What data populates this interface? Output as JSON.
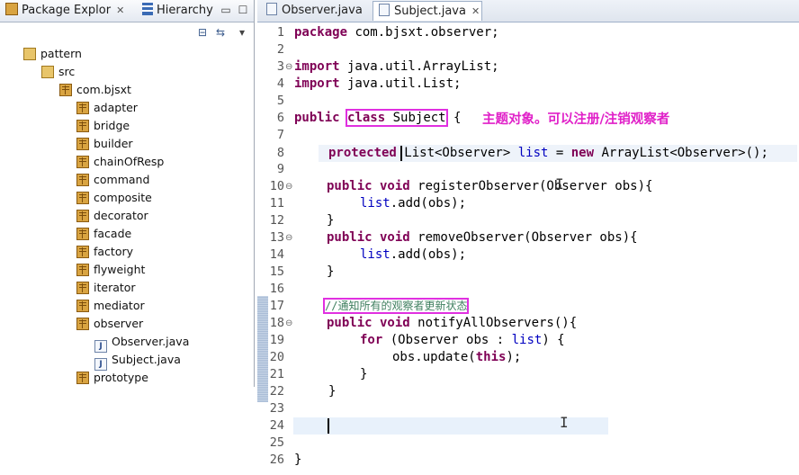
{
  "explorer": {
    "tabs": [
      {
        "label": "Package Explor",
        "close": "✕"
      },
      {
        "label": "Hierarchy",
        "close": ""
      }
    ],
    "tree": {
      "project": "pattern",
      "src": "src",
      "root_package": "com.bjsxt",
      "packages": [
        "adapter",
        "bridge",
        "builder",
        "chainOfResp",
        "command",
        "composite",
        "decorator",
        "facade",
        "factory",
        "flyweight",
        "iterator",
        "mediator",
        "observer"
      ],
      "observer_files": [
        "Observer.java",
        "Subject.java"
      ],
      "after": "prototype"
    }
  },
  "editor": {
    "tabs": [
      {
        "label": "Observer.java",
        "active": false,
        "close": ""
      },
      {
        "label": "Subject.java",
        "active": true,
        "close": "✕"
      }
    ],
    "annotation": "主题对象。可以注册/注销观察者",
    "lines": {
      "l1": {
        "kw": "package",
        "rest": " com.bjsxt.observer;"
      },
      "l3": {
        "kw": "import",
        "rest": " java.util.ArrayList;"
      },
      "l4": {
        "kw": "import",
        "rest": " java.util.List;"
      },
      "l6": {
        "kw": "public",
        "hl": "class Subject",
        "rest": " {"
      },
      "l8": {
        "kw": "protected",
        "a": " List<Observer> ",
        "fld": "list",
        "b": " = ",
        "kw2": "new",
        "c": " ArrayList<Observer>();"
      },
      "l10": {
        "kw": "public void",
        "rest": " registerObserver(Observer obs){"
      },
      "l11": {
        "fld": "list",
        "rest": ".add(obs);"
      },
      "l12": {
        "rest": "}"
      },
      "l13": {
        "kw": "public void",
        "rest": " removeObserver(Observer obs){"
      },
      "l14": {
        "fld": "list",
        "rest": ".add(obs);"
      },
      "l15": {
        "rest": "}"
      },
      "l17": {
        "comment": "//通知所有的观察者更新状态"
      },
      "l18": {
        "kw": "public void",
        "rest": " notifyAllObservers(){"
      },
      "l19": {
        "kw": "for",
        "a": " (Observer obs : ",
        "fld": "list",
        "b": ") {"
      },
      "l20": {
        "a": "obs.update(",
        "kw": "this",
        "b": ");"
      },
      "l21": {
        "rest": "}"
      },
      "l22": {
        "rest": "}"
      },
      "l26": {
        "rest": "}"
      }
    },
    "line_numbers": [
      "1",
      "2",
      "3",
      "4",
      "5",
      "6",
      "7",
      "8",
      "9",
      "10",
      "11",
      "12",
      "13",
      "14",
      "15",
      "16",
      "17",
      "18",
      "19",
      "20",
      "21",
      "22",
      "23",
      "24",
      "25",
      "26"
    ]
  }
}
